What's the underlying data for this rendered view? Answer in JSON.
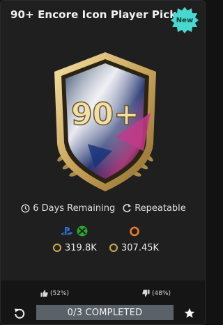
{
  "header": {
    "title": "90+ Encore Icon Player Pick",
    "badge": "New"
  },
  "pack": {
    "rating_label": "90+",
    "icon": "shield-pack-icon"
  },
  "info": {
    "time_remaining": "6 Days Remaining",
    "repeat": "Repeatable",
    "clock_icon": "clock-icon",
    "repeat_icon": "repeat-icon"
  },
  "prices": {
    "console": {
      "platforms": [
        "playstation-icon",
        "xbox-icon"
      ],
      "value": "319.8K"
    },
    "pc": {
      "platforms": [
        "origin-icon"
      ],
      "value": "307.45K"
    }
  },
  "votes": {
    "up": "(52%)",
    "down": "(48%)"
  },
  "progress": {
    "label": "0/3 COMPLETED",
    "completed": 0,
    "total": 3
  },
  "colors": {
    "accent_gold": "#d9bf7a",
    "badge_teal": "#48d8cf",
    "progress_bar": "#5a6168",
    "background": "#1f1f1f"
  }
}
